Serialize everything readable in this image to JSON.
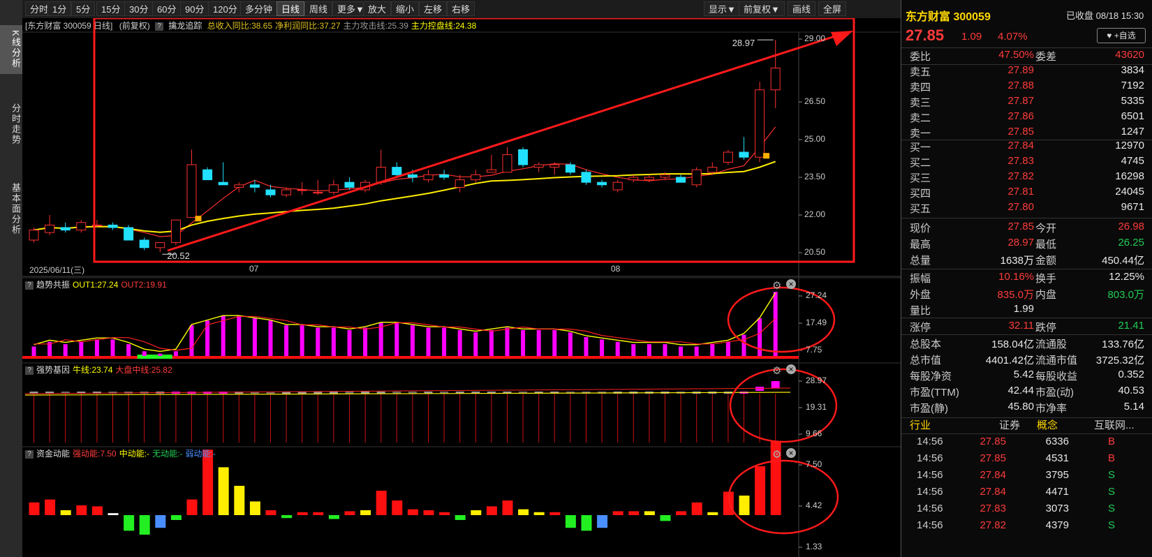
{
  "left_tabs": [
    "K线分析",
    "分时走势",
    "基本面分析"
  ],
  "toolbar": {
    "left": [
      "分时",
      "1分",
      "5分",
      "15分",
      "30分",
      "60分",
      "90分",
      "120分",
      "多分钟",
      "日线",
      "周线",
      "更多▼",
      "放大",
      "缩小",
      "左移",
      "右移"
    ],
    "active": "日线",
    "right": [
      "显示▼",
      "前复权▼",
      "画线",
      "全屏"
    ]
  },
  "main_header": {
    "stock": "[东方财富 300059 日线]",
    "adjust": "(前复权)",
    "indicator": "擒龙追踪",
    "items": [
      {
        "text": "总收入同比:38.65",
        "color": "#e0c020"
      },
      {
        "text": "净利润同比:37.27",
        "color": "#e0c020"
      },
      {
        "text": "主力攻击线:25.39",
        "color": "#999999"
      },
      {
        "text": "主力控盘线:24.38",
        "color": "#ffff00"
      }
    ]
  },
  "main_axis": [
    "29.00",
    "26.50",
    "25.00",
    "23.50",
    "22.00",
    "20.50"
  ],
  "date_labels": [
    "2025/06/11(三)",
    "07",
    "08"
  ],
  "annotations": {
    "high": "28.97",
    "low": "20.52"
  },
  "panel1": {
    "name": "趋势共振",
    "items": [
      {
        "text": "OUT1:27.24",
        "color": "#ffff00"
      },
      {
        "text": "OUT2:19.91",
        "color": "#ff3b3b"
      }
    ],
    "axis": [
      "27.24",
      "17.49",
      "7.75"
    ]
  },
  "panel2": {
    "name": "强势基因",
    "items": [
      {
        "text": "牛线:23.74",
        "color": "#ffff00"
      },
      {
        "text": "大盘中线:25.82",
        "color": "#ff3b3b"
      }
    ],
    "axis": [
      "28.97",
      "19.31",
      "9.66"
    ]
  },
  "panel3": {
    "name": "资金动能",
    "items": [
      {
        "text": "强动能:7.50",
        "color": "#ff3b3b"
      },
      {
        "text": "中动能:-",
        "color": "#ffff00"
      },
      {
        "text": "无动能:-",
        "color": "#22cc55"
      },
      {
        "text": "弱动能:-",
        "color": "#4a8fff"
      }
    ],
    "axis": [
      "7.50",
      "4.42",
      "1.33"
    ]
  },
  "chart_data": {
    "type": "candlestick",
    "dates_note": "",
    "candles": [
      [
        21.0,
        21.5,
        20.9,
        21.4
      ],
      [
        21.3,
        22.0,
        21.2,
        21.6
      ],
      [
        21.5,
        21.7,
        21.3,
        21.4
      ],
      [
        21.4,
        21.8,
        21.3,
        21.7
      ],
      [
        21.6,
        21.8,
        21.5,
        21.6
      ],
      [
        21.6,
        21.7,
        21.4,
        21.5
      ],
      [
        21.5,
        21.6,
        21.0,
        21.0
      ],
      [
        21.0,
        21.1,
        20.6,
        20.7
      ],
      [
        20.7,
        20.9,
        20.52,
        20.9
      ],
      [
        20.9,
        21.8,
        20.8,
        21.8
      ],
      [
        21.9,
        24.6,
        21.9,
        24.0
      ],
      [
        23.8,
        23.9,
        23.4,
        23.4
      ],
      [
        23.3,
        24.1,
        23.2,
        23.2
      ],
      [
        23.1,
        23.3,
        22.9,
        23.2
      ],
      [
        23.2,
        23.4,
        22.9,
        23.1
      ],
      [
        23.0,
        23.2,
        22.7,
        22.8
      ],
      [
        22.8,
        23.1,
        22.7,
        23.0
      ],
      [
        23.0,
        23.3,
        22.8,
        23.0
      ],
      [
        22.9,
        23.4,
        22.8,
        22.9
      ],
      [
        22.9,
        23.4,
        22.8,
        23.2
      ],
      [
        23.3,
        23.5,
        23.0,
        23.1
      ],
      [
        23.0,
        23.4,
        22.9,
        23.3
      ],
      [
        23.3,
        24.6,
        23.2,
        23.9
      ],
      [
        23.9,
        24.1,
        23.5,
        23.6
      ],
      [
        23.6,
        23.8,
        23.3,
        23.5
      ],
      [
        23.4,
        23.8,
        23.3,
        23.6
      ],
      [
        23.6,
        23.8,
        23.4,
        23.5
      ],
      [
        23.1,
        23.6,
        22.9,
        23.4
      ],
      [
        23.4,
        23.8,
        23.3,
        23.6
      ],
      [
        23.7,
        24.4,
        23.7,
        23.8
      ],
      [
        23.7,
        24.7,
        23.7,
        24.4
      ],
      [
        24.6,
        24.7,
        23.9,
        24.0
      ],
      [
        23.9,
        24.1,
        23.7,
        24.0
      ],
      [
        23.9,
        24.1,
        23.6,
        24.0
      ],
      [
        24.0,
        24.1,
        23.6,
        23.7
      ],
      [
        23.7,
        23.8,
        23.2,
        23.3
      ],
      [
        23.3,
        23.4,
        23.1,
        23.2
      ],
      [
        23.0,
        23.4,
        22.9,
        23.3
      ],
      [
        23.4,
        23.6,
        23.3,
        23.5
      ],
      [
        23.4,
        23.6,
        23.3,
        23.5
      ],
      [
        23.5,
        23.7,
        23.4,
        23.6
      ],
      [
        23.5,
        23.6,
        23.3,
        23.3
      ],
      [
        23.2,
        23.9,
        23.1,
        23.8
      ],
      [
        23.7,
        24.1,
        23.6,
        23.9
      ],
      [
        24.1,
        24.6,
        24.0,
        24.5
      ],
      [
        24.5,
        25.1,
        24.2,
        24.3
      ],
      [
        24.3,
        27.3,
        24.1,
        26.98
      ],
      [
        26.98,
        28.97,
        26.25,
        27.85
      ]
    ]
  }
}
